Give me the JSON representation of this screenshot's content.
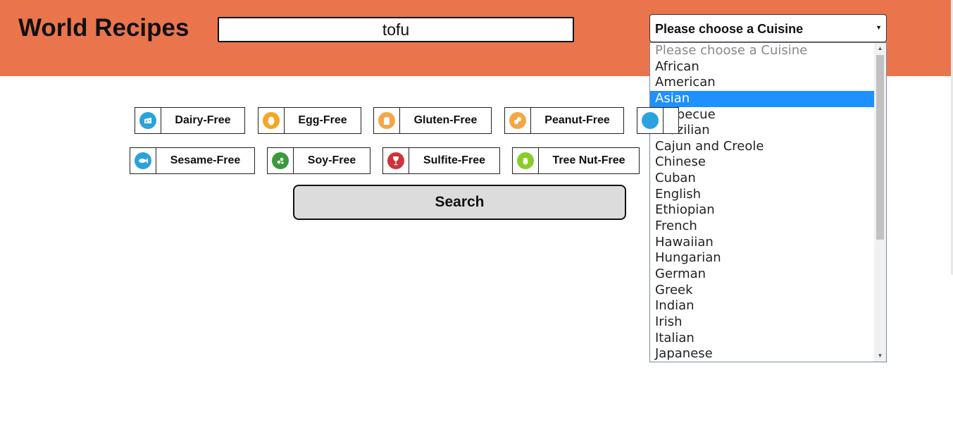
{
  "header": {
    "title": "World Recipes"
  },
  "search": {
    "value": "tofu"
  },
  "cuisine_select": {
    "selected_label": "Please choose a Cuisine",
    "options": [
      "Please choose a Cuisine",
      "African",
      "American",
      "Asian",
      "Barbecue",
      "Brazilian",
      "Cajun and Creole",
      "Chinese",
      "Cuban",
      "English",
      "Ethiopian",
      "French",
      "Hawaiian",
      "Hungarian",
      "German",
      "Greek",
      "Indian",
      "Irish",
      "Italian",
      "Japanese"
    ],
    "highlighted": "Asian"
  },
  "filters": {
    "dairy": {
      "label": "Dairy-Free",
      "icon": "cheese-icon",
      "color": "#2aa2dd"
    },
    "egg": {
      "label": "Egg-Free",
      "icon": "egg-icon",
      "color": "#f5a623"
    },
    "gluten": {
      "label": "Gluten-Free",
      "icon": "bread-icon",
      "color": "#f5a646"
    },
    "peanut": {
      "label": "Peanut-Free",
      "icon": "peanut-icon",
      "color": "#f5a646"
    },
    "sesame": {
      "label": "Sesame-Free",
      "icon": "fish-icon",
      "color": "#2aa2dd"
    },
    "soy": {
      "label": "Soy-Free",
      "icon": "soy-icon",
      "color": "#3a9a3a"
    },
    "sulfite": {
      "label": "Sulfite-Free",
      "icon": "wine-icon",
      "color": "#d0333a"
    },
    "treenut": {
      "label": "Tree Nut-Free",
      "icon": "acorn-icon",
      "color": "#8ccc2a"
    }
  },
  "search_button": {
    "label": "Search"
  },
  "colors": {
    "header_bg": "#ea754d",
    "highlight": "#1e90ff"
  }
}
